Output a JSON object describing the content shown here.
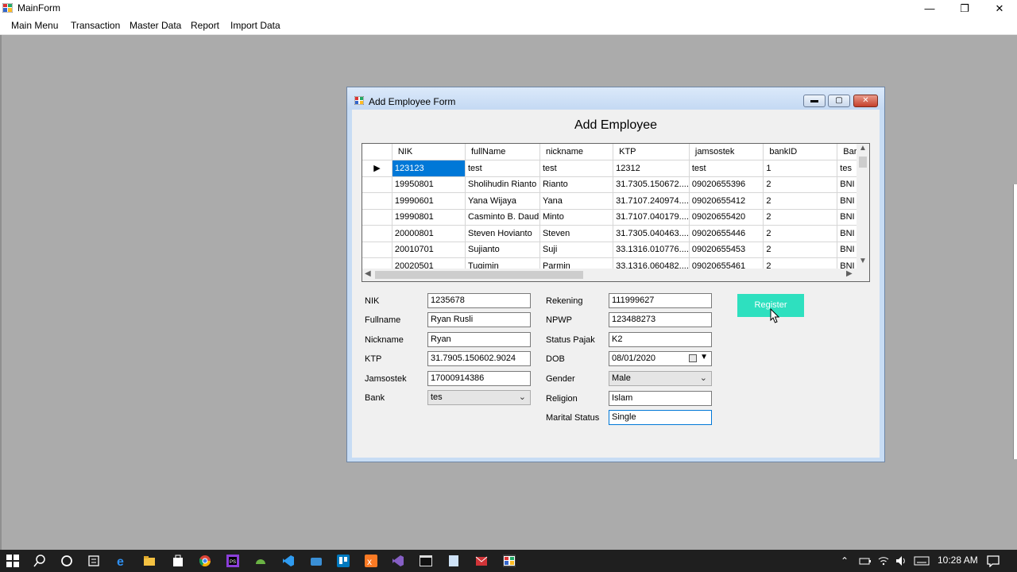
{
  "window": {
    "title": "MainForm"
  },
  "menu": [
    "Main Menu",
    "Transaction",
    "Master Data",
    "Report",
    "Import Data"
  ],
  "child_form": {
    "title": "Add Employee Form",
    "heading": "Add Employee"
  },
  "grid": {
    "columns": [
      "NIK",
      "fullName",
      "nickname",
      "KTP",
      "jamsostek",
      "bankID",
      "Bar"
    ],
    "rows": [
      [
        "123123",
        "test",
        "test",
        "12312",
        "test",
        "1",
        "tes"
      ],
      [
        "19950801",
        "Sholihudin Rianto",
        "Rianto",
        "31.7305.150672....",
        "09020655396",
        "2",
        "BNI"
      ],
      [
        "19990601",
        "Yana Wijaya",
        "Yana",
        "31.7107.240974....",
        "09020655412",
        "2",
        "BNI"
      ],
      [
        "19990801",
        "Casminto B. Daud",
        "Minto",
        "31.7107.040179....",
        "09020655420",
        "2",
        "BNI"
      ],
      [
        "20000801",
        "Steven Hovianto",
        "Steven",
        "31.7305.040463....",
        "09020655446",
        "2",
        "BNI"
      ],
      [
        "20010701",
        "Sujianto",
        "Suji",
        "33.1316.010776....",
        "09020655453",
        "2",
        "BNI"
      ],
      [
        "20020501",
        "Tugimin",
        "Parmin",
        "33.1316.060482....",
        "09020655461",
        "2",
        "BNI"
      ]
    ]
  },
  "form": {
    "nik": {
      "label": "NIK",
      "value": "1235678"
    },
    "fullname": {
      "label": "Fullname",
      "value": "Ryan Rusli"
    },
    "nickname": {
      "label": "Nickname",
      "value": "Ryan"
    },
    "ktp": {
      "label": "KTP",
      "value": "31.7905.150602.9024"
    },
    "jamsostek": {
      "label": "Jamsostek",
      "value": "17000914386"
    },
    "bank": {
      "label": "Bank",
      "value": "tes"
    },
    "rekening": {
      "label": "Rekening",
      "value": "111999627"
    },
    "npwp": {
      "label": "NPWP",
      "value": "123488273"
    },
    "status_pajak": {
      "label": "Status Pajak",
      "value": "K2"
    },
    "dob": {
      "label": "DOB",
      "value": "08/01/2020"
    },
    "gender": {
      "label": "Gender",
      "value": "Male"
    },
    "religion": {
      "label": "Religion",
      "value": "Islam"
    },
    "marital_status": {
      "label": "Marital Status",
      "value": "Single"
    },
    "register_label": "Register"
  },
  "taskbar": {
    "time": "10:28 AM"
  },
  "colors": {
    "accent": "#2ee0bf",
    "selection": "#0078d7"
  }
}
